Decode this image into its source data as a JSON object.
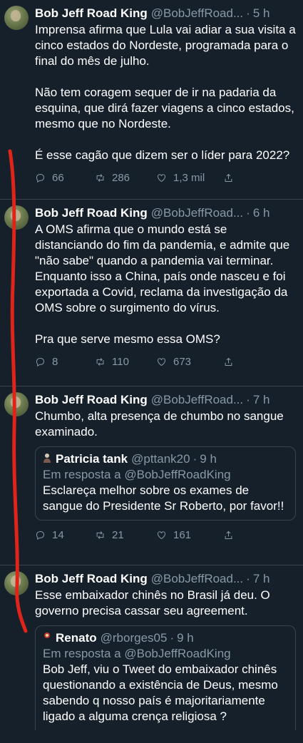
{
  "colors": {
    "background": "#15202b",
    "secondary_text": "#8899a6",
    "border": "#38444d",
    "annotation": "#e0241a"
  },
  "tweets": [
    {
      "name": "Bob Jeff Road King",
      "handle": "@BobJeffRoad...",
      "time": "5 h",
      "text": "Imprensa afirma que Lula vai adiar a sua visita a cinco estados do Nordeste, programada para o final do mês de julho.\n\nNão tem coragem sequer de ir na padaria da esquina, que dirá fazer viagens a cinco estados, mesmo que no Nordeste.\n\nÉ esse cagão que dizem ser o líder para 2022?",
      "replies": "66",
      "retweets": "286",
      "likes": "1,3 mil"
    },
    {
      "name": "Bob Jeff Road King",
      "handle": "@BobJeffRoad...",
      "time": "6 h",
      "text": "A OMS afirma que o mundo está se distanciando do fim da pandemia, e admite que \"não sabe\" quando a pandemia vai terminar. Enquanto isso a China, país onde nasceu e foi exportada a Covid, reclama da investigação da OMS sobre o surgimento do vírus.\n\nPra que serve mesmo essa OMS?",
      "replies": "8",
      "retweets": "110",
      "likes": "673"
    },
    {
      "name": "Bob Jeff Road King",
      "handle": "@BobJeffRoad...",
      "time": "7 h",
      "text": "Chumbo, alta presença de chumbo no sangue examinado.",
      "quote": {
        "name": "Patricia tank",
        "handle": "@pttank20",
        "time": "9 h",
        "reply_prefix": "Em resposta a",
        "reply_to": "@BobJeffRoadKing",
        "text": "Esclareça melhor sobre os exames de sangue do Presidente Sr Roberto, por favor!!"
      },
      "replies": "14",
      "retweets": "21",
      "likes": "161"
    },
    {
      "name": "Bob Jeff Road King",
      "handle": "@BobJeffRoad...",
      "time": "7 h",
      "text": "Esse embaixador chinês no Brasil já deu. O governo precisa cassar seu agreement.",
      "quote": {
        "name": "Renato",
        "handle": "@rborges05",
        "time": "9 h",
        "reply_prefix": "Em resposta a",
        "reply_to": "@BobJeffRoadKing",
        "text": "Bob Jeff, viu o Tweet do embaixador chinês questionando a existência de Deus, mesmo sabendo q nosso país é majoritariamente ligado a alguma crença religiosa ?"
      }
    }
  ]
}
